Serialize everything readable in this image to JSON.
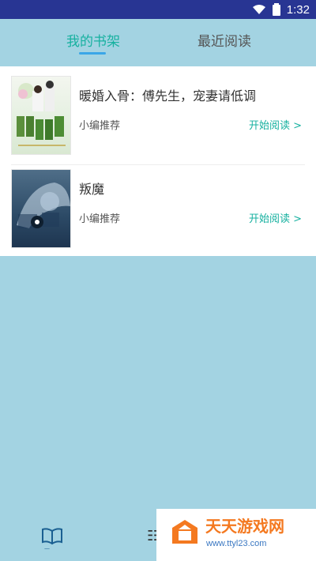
{
  "status_bar": {
    "time": "1:32"
  },
  "tabs": [
    {
      "label": "我的书架",
      "active": true
    },
    {
      "label": "最近阅读",
      "active": false
    }
  ],
  "books": [
    {
      "title": "暖婚入骨：傅先生，宠妻请低调",
      "subtitle": "小编推荐",
      "action": "开始阅读 >"
    },
    {
      "title": "叛魔",
      "subtitle": "小编推荐",
      "action": "开始阅读 >"
    }
  ],
  "colors": {
    "accent": "#17b1a0",
    "page_bg": "#a3d3e2",
    "status_bar": "#283593"
  },
  "watermark": {
    "title": "天天游戏网",
    "url": "www.ttyl23.com"
  },
  "icons": [
    "wifi-icon",
    "battery-icon",
    "book-icon",
    "shelf-icon"
  ]
}
